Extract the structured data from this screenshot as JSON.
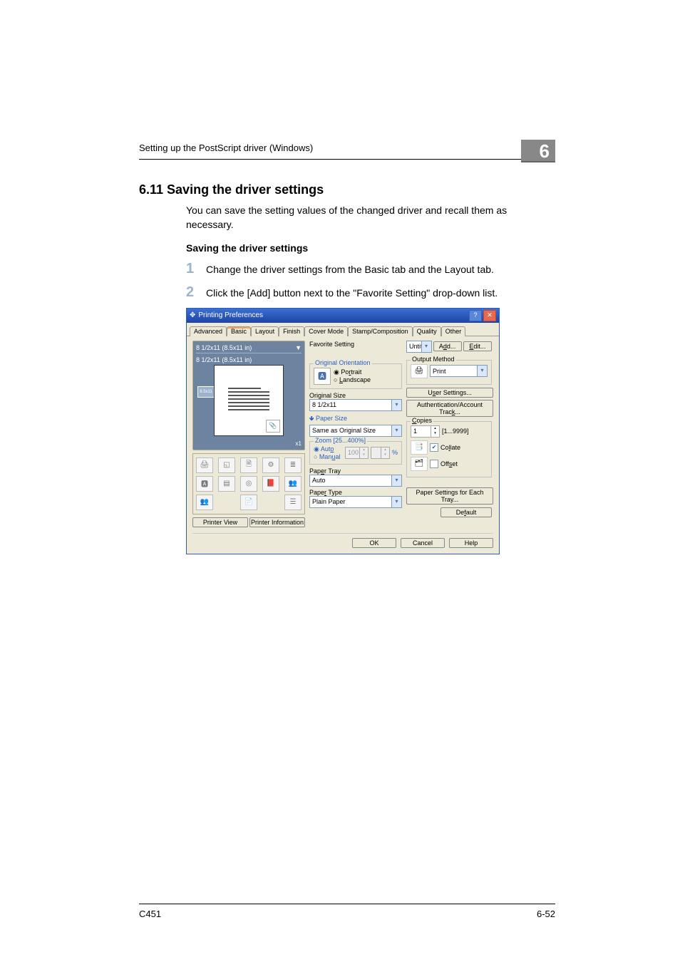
{
  "running_head": "Setting up the PostScript driver (Windows)",
  "chapter_number": "6",
  "section_heading": "6.11   Saving the driver settings",
  "intro": "You can save the setting values of the changed driver and recall them as necessary.",
  "sub_heading": "Saving the driver settings",
  "steps": [
    {
      "num": "1",
      "text": "Change the driver settings from the Basic tab and the Layout tab."
    },
    {
      "num": "2",
      "text": "Click the [Add] button next to the \"Favorite Setting\" drop-down list."
    }
  ],
  "dialog": {
    "title": "Printing Preferences",
    "tabs": [
      "Advanced",
      "Basic",
      "Layout",
      "Finish",
      "Cover Mode",
      "Stamp/Composition",
      "Quality",
      "Other"
    ],
    "active_tab": "Basic",
    "preview": {
      "src_size": "8 1/2x11 (8.5x11 in)",
      "expand": "▼",
      "out_size": "8 1/2x11 (8.5x11 in)",
      "foot": "x1"
    },
    "left_buttons": {
      "pv": "Printer View",
      "pi": "Printer Information"
    },
    "favorite": {
      "label": "Favorite Setting",
      "value": "Untitled",
      "add": "Add...",
      "edit": "Edit..."
    },
    "orientation": {
      "legend": "Original Orientation",
      "portrait": "Portrait",
      "landscape": "Landscape"
    },
    "original_size": {
      "label": "Original Size",
      "value": "8 1/2x11"
    },
    "paper_size": {
      "label": "Paper Size",
      "value": "Same as Original Size"
    },
    "zoom": {
      "legend": "Zoom [25...400%]",
      "auto": "Auto",
      "manual": "Manual",
      "value": "100",
      "unit": "%"
    },
    "paper_tray": {
      "label": "Paper Tray",
      "value": "Auto"
    },
    "paper_type": {
      "label": "Paper Type",
      "value": "Plain Paper"
    },
    "output_method": {
      "label": "Output Method",
      "value": "Print"
    },
    "user_settings": "User Settings...",
    "auth_track": "Authentication/Account Track...",
    "copies": {
      "label": "Copies",
      "value": "1",
      "range": "[1...9999]"
    },
    "collate": "Collate",
    "offset": "Offset",
    "each_tray": "Paper Settings for Each Tray...",
    "default": "Default",
    "ok": "OK",
    "cancel": "Cancel",
    "help": "Help"
  },
  "footer": {
    "left": "C451",
    "right": "6-52"
  }
}
